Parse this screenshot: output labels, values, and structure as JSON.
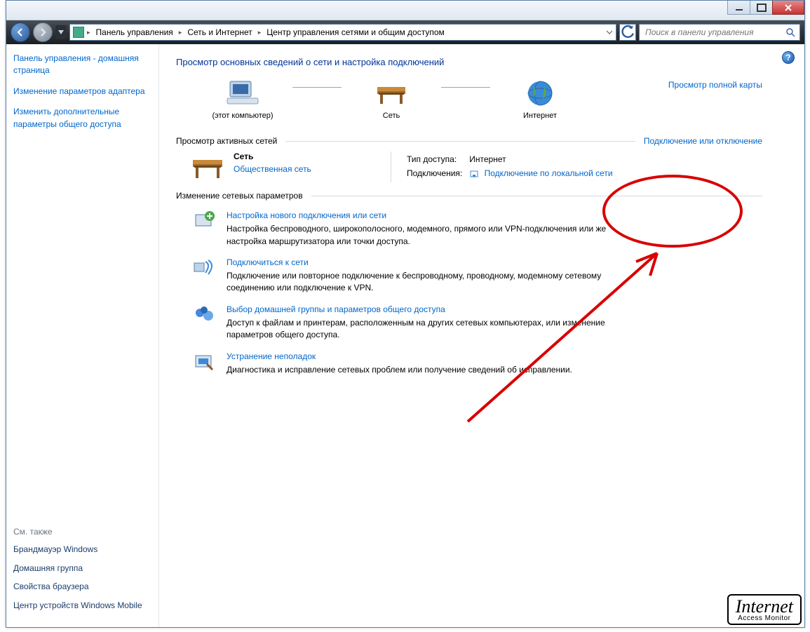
{
  "breadcrumbs": {
    "b1": "Панель управления",
    "b2": "Сеть и Интернет",
    "b3": "Центр управления сетями и общим доступом"
  },
  "search": {
    "placeholder": "Поиск в панели управления"
  },
  "sidebar": {
    "link0": "Панель управления - домашняя страница",
    "link1": "Изменение параметров адаптера",
    "link2": "Изменить дополнительные параметры общего доступа",
    "seealso_hdr": "См. также",
    "sa0": "Брандмауэр Windows",
    "sa1": "Домашняя группа",
    "sa2": "Свойства браузера",
    "sa3": "Центр устройств Windows Mobile"
  },
  "main": {
    "title": "Просмотр основных сведений о сети и настройка подключений",
    "node0": "(этот компьютер)",
    "node1": "Сеть",
    "node2": "Интернет",
    "fullmap": "Просмотр полной карты",
    "sect_active": "Просмотр активных сетей",
    "connect_toggle": "Подключение или отключение",
    "net_name": "Сеть",
    "net_type": "Общественная сеть",
    "label_access": "Тип доступа:",
    "val_access": "Интернет",
    "label_conn": "Подключения:",
    "val_conn": "Подключение по локальной сети",
    "sect_change": "Изменение сетевых параметров",
    "task0_t": "Настройка нового подключения или сети",
    "task0_d": "Настройка беспроводного, широкополосного, модемного, прямого или VPN-подключения или же настройка маршрутизатора или точки доступа.",
    "task1_t": "Подключиться к сети",
    "task1_d": "Подключение или повторное подключение к беспроводному, проводному, модемному сетевому соединению или подключение к VPN.",
    "task2_t": "Выбор домашней группы и параметров общего доступа",
    "task2_d": "Доступ к файлам и принтерам, расположенным на других сетевых компьютерах, или изменение параметров общего доступа.",
    "task3_t": "Устранение неполадок",
    "task3_d": "Диагностика и исправление сетевых проблем или получение сведений об исправлении."
  },
  "watermark": {
    "l1": "Internet",
    "l2": "Access Monitor"
  }
}
